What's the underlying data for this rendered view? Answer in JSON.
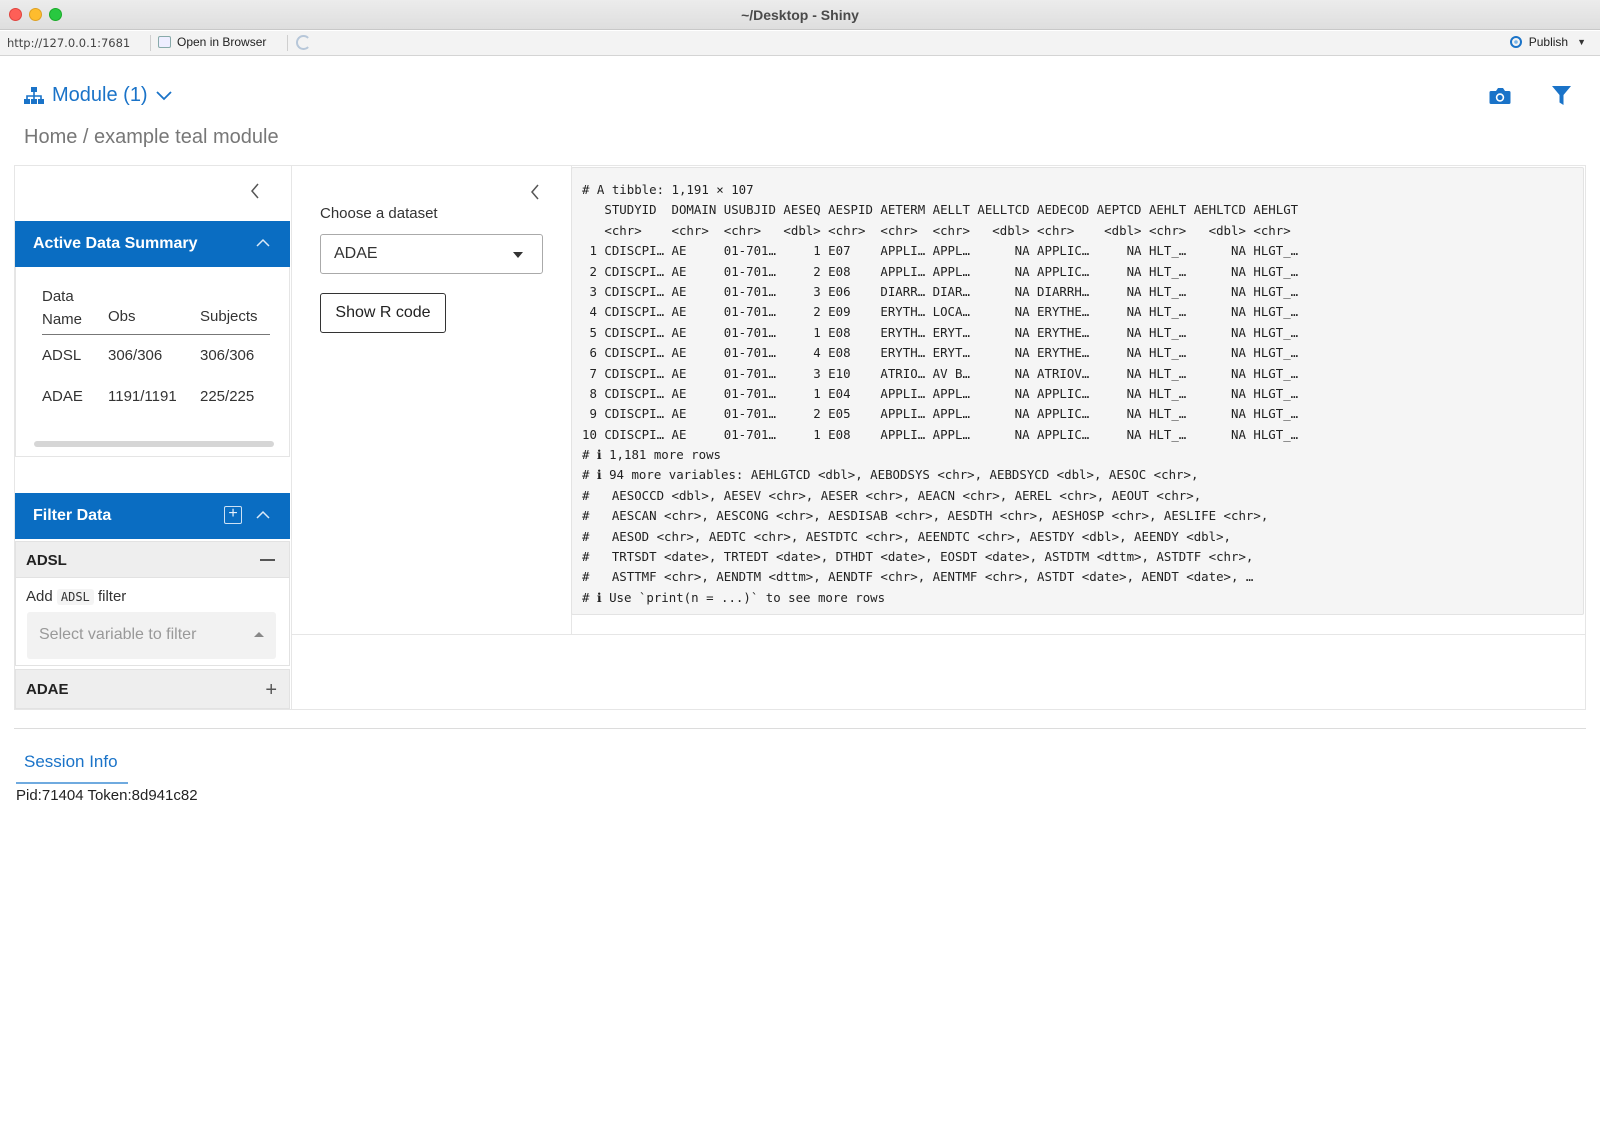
{
  "window": {
    "title": "~/Desktop - Shiny"
  },
  "addressbar": {
    "url": "http://127.0.0.1:7681",
    "open_in_browser": "Open in Browser",
    "publish": "Publish"
  },
  "header": {
    "module_menu": "Module (1)",
    "breadcrumb": "Home / example teal module"
  },
  "active_data_summary": {
    "title": "Active Data Summary",
    "columns": [
      "Data Name",
      "Obs",
      "Subjects"
    ],
    "rows": [
      [
        "ADSL",
        "306/306",
        "306/306"
      ],
      [
        "ADAE",
        "1191/1191",
        "225/225"
      ]
    ]
  },
  "filter_data": {
    "title": "Filter Data",
    "adsl": {
      "name": "ADSL",
      "add_prefix": "Add",
      "add_tag": "ADSL",
      "add_suffix": "filter",
      "select_placeholder": "Select variable to filter"
    },
    "adae": {
      "name": "ADAE"
    }
  },
  "encoding": {
    "choose_label": "Choose a dataset",
    "selected_dataset": "ADAE",
    "show_code": "Show R code"
  },
  "output": {
    "lines": [
      "# A tibble: 1,191 × 107",
      "   STUDYID  DOMAIN USUBJID AESEQ AESPID AETERM AELLT AELLTCD AEDECOD AEPTCD AEHLT AEHLTCD AEHLGT",
      "   <chr>    <chr>  <chr>   <dbl> <chr>  <chr>  <chr>   <dbl> <chr>    <dbl> <chr>   <dbl> <chr>",
      " 1 CDISCPI… AE     01-701…     1 E07    APPLI… APPL…      NA APPLIC…     NA HLT_…      NA HLGT_…",
      " 2 CDISCPI… AE     01-701…     2 E08    APPLI… APPL…      NA APPLIC…     NA HLT_…      NA HLGT_…",
      " 3 CDISCPI… AE     01-701…     3 E06    DIARR… DIAR…      NA DIARRH…     NA HLT_…      NA HLGT_…",
      " 4 CDISCPI… AE     01-701…     2 E09    ERYTH… LOCA…      NA ERYTHE…     NA HLT_…      NA HLGT_…",
      " 5 CDISCPI… AE     01-701…     1 E08    ERYTH… ERYT…      NA ERYTHE…     NA HLT_…      NA HLGT_…",
      " 6 CDISCPI… AE     01-701…     4 E08    ERYTH… ERYT…      NA ERYTHE…     NA HLT_…      NA HLGT_…",
      " 7 CDISCPI… AE     01-701…     3 E10    ATRIO… AV B…      NA ATRIOV…     NA HLT_…      NA HLGT_…",
      " 8 CDISCPI… AE     01-701…     1 E04    APPLI… APPL…      NA APPLIC…     NA HLT_…      NA HLGT_…",
      " 9 CDISCPI… AE     01-701…     2 E05    APPLI… APPL…      NA APPLIC…     NA HLT_…      NA HLGT_…",
      "10 CDISCPI… AE     01-701…     1 E08    APPLI… APPL…      NA APPLIC…     NA HLT_…      NA HLGT_…",
      "# ℹ 1,181 more rows",
      "# ℹ 94 more variables: AEHLGTCD <dbl>, AEBODSYS <chr>, AEBDSYCD <dbl>, AESOC <chr>,",
      "#   AESOCCD <dbl>, AESEV <chr>, AESER <chr>, AEACN <chr>, AEREL <chr>, AEOUT <chr>,",
      "#   AESCAN <chr>, AESCONG <chr>, AESDISAB <chr>, AESDTH <chr>, AESHOSP <chr>, AESLIFE <chr>,",
      "#   AESOD <chr>, AEDTC <chr>, AESTDTC <chr>, AEENDTC <chr>, AESTDY <dbl>, AEENDY <dbl>,",
      "#   TRTSDT <date>, TRTEDT <date>, DTHDT <date>, EOSDT <date>, ASTDTM <dttm>, ASTDTF <chr>,",
      "#   ASTTMF <chr>, AENDTM <dttm>, AENDTF <chr>, AENTMF <chr>, ASTDT <date>, AENDT <date>, …",
      "# ℹ Use `print(n = ...)` to see more rows"
    ]
  },
  "footer": {
    "session_tab": "Session Info",
    "session_text": "Pid:71404 Token:8d941c82"
  },
  "colors": {
    "accent": "#0a6dc2",
    "link": "#1a73c8"
  },
  "icons": [
    "sitemap-icon",
    "chevron-down-icon",
    "camera-icon",
    "filter-icon",
    "chevron-left-icon",
    "chevron-up-icon",
    "plus-square-icon",
    "minus-icon",
    "plus-icon",
    "refresh-icon",
    "publish-icon"
  ]
}
